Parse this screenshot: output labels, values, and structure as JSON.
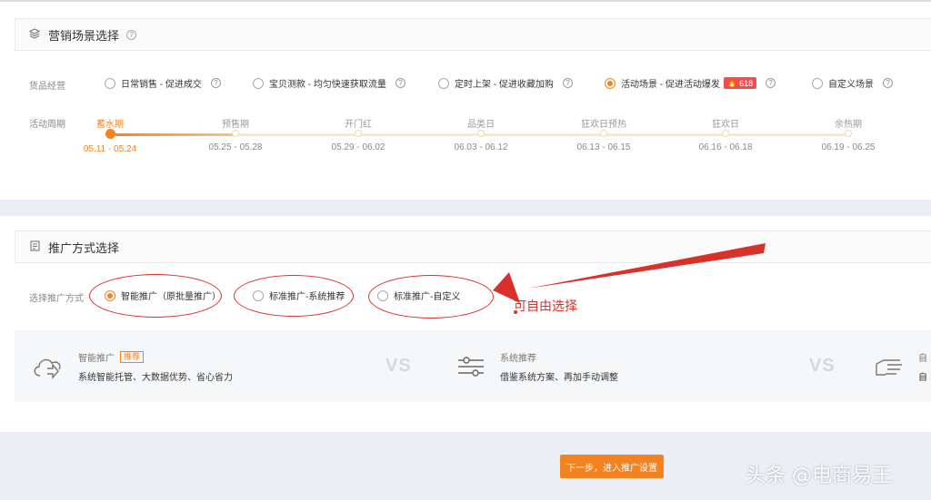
{
  "marketing": {
    "title": "营销场景选择",
    "goods_label": "货品经营",
    "scenes": [
      {
        "label": "日常销售 - 促进成交",
        "selected": false
      },
      {
        "label": "宝贝测款 - 均匀快速获取流量",
        "selected": false
      },
      {
        "label": "定时上架 - 促进收藏加购",
        "selected": false
      },
      {
        "label": "活动场景 - 促进活动爆发",
        "selected": true,
        "badge": "618"
      },
      {
        "label": "自定义场景",
        "selected": false
      }
    ],
    "period_label": "活动周期",
    "stages": [
      {
        "name": "蓄水期",
        "date": "05.11 - 05.24",
        "active": true
      },
      {
        "name": "预售期",
        "date": "05.25 - 05.28",
        "active": false
      },
      {
        "name": "开门红",
        "date": "05.29 - 06.02",
        "active": false
      },
      {
        "name": "品类日",
        "date": "06.03 - 06.12",
        "active": false
      },
      {
        "name": "狂欢日预热",
        "date": "06.13 - 06.15",
        "active": false
      },
      {
        "name": "狂欢日",
        "date": "06.16 - 06.18",
        "active": false
      },
      {
        "name": "余热期",
        "date": "06.19 - 06.25",
        "active": false
      }
    ]
  },
  "promotion": {
    "title": "推广方式选择",
    "method_label": "选择推广方式",
    "methods": [
      {
        "label": "智能推广（原批量推广）",
        "selected": true
      },
      {
        "label": "标准推广-系统推荐",
        "selected": false
      },
      {
        "label": "标准推广-自定义",
        "selected": false
      }
    ],
    "annotation": "可自由选择",
    "compare": {
      "smart": {
        "title": "智能推广",
        "tag": "推荐",
        "desc": "系统智能托管、大数据优势、省心省力"
      },
      "system": {
        "title": "系统推荐",
        "desc": "借鉴系统方案、再加手动调整"
      },
      "custom": {
        "title": "自",
        "desc": "自"
      },
      "vs": "VS"
    }
  },
  "footer": {
    "next_label": "下一步，进入推广设置",
    "watermark": "头条 @电商易王"
  },
  "colors": {
    "accent": "#f58220",
    "annotation": "#d9302a",
    "badge": "#f04e4e"
  }
}
